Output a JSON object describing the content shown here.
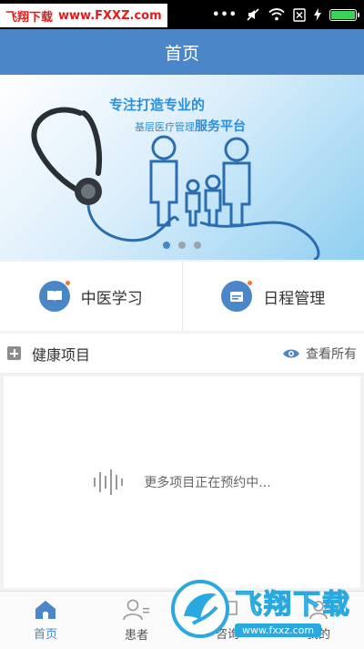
{
  "status_bar": {
    "watermark_top": {
      "brand": "飞翔下载",
      "url": "www.FXXZ.com"
    },
    "icons": [
      "signal-dots-icon",
      "mute-icon",
      "wifi-icon",
      "sim-off-icon",
      "charging-icon",
      "battery-icon"
    ],
    "battery_level": 1.0,
    "battery_color": "#3bd35a"
  },
  "header": {
    "title": "首页",
    "color": "#4a86c8"
  },
  "banner": {
    "headline": "专注打造专业的",
    "subline_prefix": "基层医疗管理",
    "subline_emphasis": "服务平台",
    "carousel_total": 3,
    "carousel_active": 1
  },
  "quick_entries": [
    {
      "label": "中医学习",
      "icon": "book-icon"
    },
    {
      "label": "日程管理",
      "icon": "calendar-icon"
    }
  ],
  "health_projects": {
    "title": "健康项目",
    "view_all": "查看所有",
    "empty_text": "更多项目正在预约中..."
  },
  "bottom_nav": [
    {
      "label": "首页",
      "icon": "home-icon",
      "active": true
    },
    {
      "label": "患者",
      "icon": "patient-icon",
      "active": false
    },
    {
      "label": "咨询",
      "icon": "consult-icon",
      "active": false
    },
    {
      "label": "我的",
      "icon": "profile-icon",
      "active": false
    }
  ],
  "watermark_bottom": {
    "brand": "飞翔下载",
    "url": "www.fxxz.com"
  },
  "colors": {
    "accent": "#4a86c8",
    "badge": "#f0792b",
    "watermark": "#2aa8e0"
  }
}
